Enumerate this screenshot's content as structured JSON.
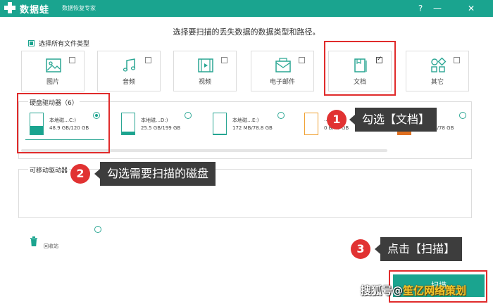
{
  "app": {
    "name": "数据蛙",
    "subtitle": "数据恢复专家",
    "window_controls": [
      "?",
      "—",
      "✕"
    ]
  },
  "instruction": "选择要扫描的丢失数据的数据类型和路径。",
  "select_all": {
    "label": "选择所有文件类型",
    "checked": true
  },
  "file_types": [
    {
      "label": "图片",
      "icon": "image-icon",
      "checked": false
    },
    {
      "label": "音频",
      "icon": "music-note-icon",
      "checked": false
    },
    {
      "label": "视频",
      "icon": "video-icon",
      "checked": false
    },
    {
      "label": "电子邮件",
      "icon": "email-icon",
      "checked": false
    },
    {
      "label": "文档",
      "icon": "document-icon",
      "checked": true
    },
    {
      "label": "其它",
      "icon": "other-icon",
      "checked": false
    }
  ],
  "hard_drives": {
    "title": "硬盘驱动器（6）",
    "items": [
      {
        "name": "本地磁…C:)",
        "size": "48.9 GB/120 GB",
        "selected": true,
        "fill_fraction": 0.4,
        "color": "#1aa48f"
      },
      {
        "name": "本地磁…D:)",
        "size": "25.5 GB/199 GB",
        "selected": false,
        "fill_fraction": 0.13,
        "color": "#1aa48f"
      },
      {
        "name": "本地磁…E:)",
        "size": "172 MB/78.8 GB",
        "selected": false,
        "fill_fraction": 0.02,
        "color": "#1aa48f"
      },
      {
        "name": "…",
        "size": "0  B/78 GB",
        "selected": false,
        "fill_fraction": 0.0,
        "color": "#f0a030"
      },
      {
        "name": "",
        "size": "57.0 MB/78 GB",
        "selected": false,
        "fill_fraction": 0.01,
        "color": "#e07020"
      }
    ]
  },
  "removable_drives": {
    "title": "可移动驱动器"
  },
  "recycle_bin": {
    "label": "回收站"
  },
  "scan_button": {
    "label": "扫描"
  },
  "callouts": [
    {
      "number": "1",
      "text": "勾选【文档】"
    },
    {
      "number": "2",
      "text": "勾选需要扫描的磁盘"
    },
    {
      "number": "3",
      "text": "点击【扫描】"
    }
  ],
  "watermark": {
    "prefix": "搜狐号@",
    "accent": "笙亿网络策划"
  }
}
